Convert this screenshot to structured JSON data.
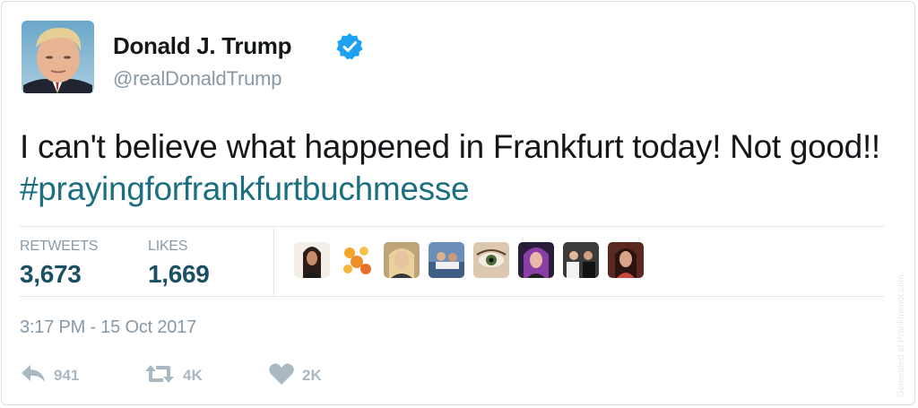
{
  "user": {
    "name": "Donald J. Trump",
    "handle": "@realDonaldTrump",
    "verified": true
  },
  "tweet": {
    "text": "I can't believe what happened in Frankfurt today! Not good!!",
    "hashtag": "#prayingforfrankfurtbuchmesse"
  },
  "stats": {
    "retweets_label": "RETWEETS",
    "retweets_value": "3,673",
    "likes_label": "LIKES",
    "likes_value": "1,669"
  },
  "liker_avatars": [
    {
      "name": "liker-avatar-1",
      "tone": "#3a2b22"
    },
    {
      "name": "liker-avatar-2",
      "tone": "#f2a33a"
    },
    {
      "name": "liker-avatar-3",
      "tone": "#d9b98a"
    },
    {
      "name": "liker-avatar-4",
      "tone": "#4a6f9c"
    },
    {
      "name": "liker-avatar-5",
      "tone": "#5c6b4a"
    },
    {
      "name": "liker-avatar-6",
      "tone": "#8a4b9a"
    },
    {
      "name": "liker-avatar-7",
      "tone": "#2a2a2a"
    },
    {
      "name": "liker-avatar-8",
      "tone": "#b0504a"
    }
  ],
  "timestamp": "3:17 PM - 15 Oct 2017",
  "actions": {
    "reply_count": "941",
    "retweet_count": "4K",
    "like_count": "2K"
  },
  "watermark": "Generated at Prankmenot.com",
  "colors": {
    "hashtag": "#1b6f80",
    "stat_value": "#1b4f63",
    "muted": "#8899a6",
    "verified": "#1da1f2",
    "action_icon": "#aab8c2"
  }
}
